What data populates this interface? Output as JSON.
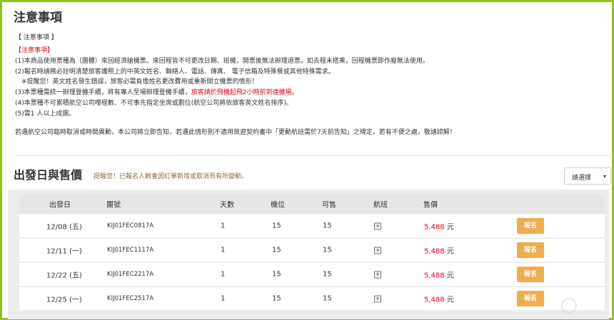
{
  "notice": {
    "title": "注意事項",
    "header": "【 注意事項 】",
    "red_header": "【注意事項】",
    "lines": {
      "l1": "(1)本商品使用票種為（團體）來回經濟艙機票。來回程皆不可更改日期、班機，開票後無法辦理退票。如去程未搭乘，回程機票即作廢無法使用。",
      "l2": "(2)報名時請務必註明清楚旅客護照上的中英文姓名、聯絡人、電話、傳真、 電子信箱及特殊餐或其他特殊需求。",
      "l3": "※提醒您！英文姓名發生錯誤，旅客必需負擔姓名更改費用或重新開立機票的情形！",
      "l4a": "(3)本票種需統一辦理登機手續，將有專人至場辦理登機手續，",
      "l4b": "旅客請於飛機起飛2小時前到達機場",
      "l4c": "。",
      "l5": "(4)本票種不可累積航空公司哩程數、不可事先指定坐席或劃位(航空公司將依旅客英文姓名排序)。",
      "l6": "(5)需1 人以上成團。"
    },
    "closing": "若遇航空公司臨時取消或時間異動，本公司將立即告知，若遇此情形則不適用旅遊契約書中「更動航班需於7天前告知」之規定。若有不便之處，敬請諒解！"
  },
  "departure": {
    "title": "出發日與售價",
    "hint": "提醒您！已報名人數會因訂單新增或取消而有所變動。",
    "select_label": "請選擇",
    "columns": {
      "date": "出發日",
      "code": "團號",
      "days": "天數",
      "seats": "機位",
      "available": "可售",
      "flight": "航班",
      "price": "售價"
    },
    "rows": [
      {
        "date": "12/08 (五)",
        "code": "KIJ01FEC0817A",
        "days": "1",
        "seats": "15",
        "available": "15",
        "price": "5,488",
        "currency": "元",
        "action": "報名"
      },
      {
        "date": "12/11 (一)",
        "code": "KIJ01FEC1117A",
        "days": "1",
        "seats": "15",
        "available": "15",
        "price": "5,488",
        "currency": "元",
        "action": "報名"
      },
      {
        "date": "12/22 (五)",
        "code": "KIJ01FEC2217A",
        "days": "1",
        "seats": "15",
        "available": "15",
        "price": "5,488",
        "currency": "元",
        "action": "報名"
      },
      {
        "date": "12/25 (一)",
        "code": "KIJ01FEC2517A",
        "days": "1",
        "seats": "15",
        "available": "15",
        "price": "5,488",
        "currency": "元",
        "action": "報名"
      }
    ]
  },
  "colors": {
    "frame": "#8dc21f",
    "accent_red": "#e60012",
    "button": "#f0ad4e"
  }
}
